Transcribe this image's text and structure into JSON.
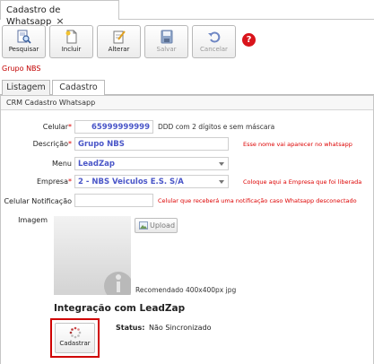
{
  "window": {
    "tab_title": "Cadastro de Whatsapp",
    "close_glyph": "×"
  },
  "toolbar": [
    {
      "label": "Pesquisar",
      "icon": "search-document-icon",
      "enabled": true
    },
    {
      "label": "Incluir",
      "icon": "new-document-icon",
      "enabled": true
    },
    {
      "label": "Alterar",
      "icon": "edit-document-icon",
      "enabled": true
    },
    {
      "label": "Salvar",
      "icon": "save-disk-icon",
      "enabled": false
    },
    {
      "label": "Cancelar",
      "icon": "undo-icon",
      "enabled": false
    }
  ],
  "help": {
    "glyph": "?",
    "color": "#d9141b"
  },
  "company": "Grupo NBS",
  "tabs": [
    {
      "label": "Listagem",
      "active": false
    },
    {
      "label": "Cadastro",
      "active": true
    }
  ],
  "panel_title": "CRM Cadastro Whatsapp",
  "form": {
    "celular": {
      "label": "Celular",
      "required_mark": "*",
      "value": "65999999999",
      "hint": "DDD com 2 dígitos e sem máscara"
    },
    "descricao": {
      "label": "Descrição",
      "required_mark": "*",
      "value": "Grupo NBS",
      "hint": "Esse nome vai aparecer no whatsapp"
    },
    "menu": {
      "label": "Menu",
      "value": "LeadZap"
    },
    "empresa": {
      "label": "Empresa",
      "required_mark": "*",
      "value": "2 - NBS Veiculos E.S. S/A",
      "hint": "Coloque aqui a Empresa que foi liberada"
    },
    "celular_notificacao": {
      "label": "Celular Notificação",
      "value": "",
      "hint": "Celular que receberá uma notificação caso Whatsapp desconectado"
    },
    "imagem": {
      "label": "Imagem",
      "upload_label": "Upload",
      "recommendation": "Recomendado 400x400px jpg"
    }
  },
  "integracao": {
    "title": "Integração com LeadZap",
    "button_label": "Cadastrar",
    "status_label": "Status:",
    "status_value": "Não Sincronizado"
  },
  "colors": {
    "accent_red": "#d00000",
    "value_blue": "#4a56c8"
  }
}
